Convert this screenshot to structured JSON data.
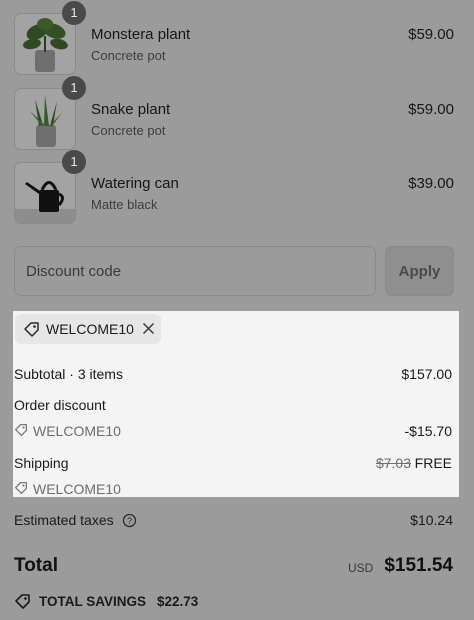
{
  "items": [
    {
      "name": "Monstera plant",
      "variant": "Concrete pot",
      "price": "$59.00",
      "qty": "1"
    },
    {
      "name": "Snake plant",
      "variant": "Concrete pot",
      "price": "$59.00",
      "qty": "1"
    },
    {
      "name": "Watering can",
      "variant": "Matte black",
      "price": "$39.00",
      "qty": "1"
    }
  ],
  "discount": {
    "placeholder": "Discount code",
    "apply_label": "Apply"
  },
  "applied_code": "WELCOME10",
  "summary": {
    "subtotal_label": "Subtotal · 3 items",
    "subtotal_value": "$157.00",
    "order_discount_label": "Order discount",
    "order_discount_code": "WELCOME10",
    "order_discount_value": "-$15.70",
    "shipping_label": "Shipping",
    "shipping_original": "$7.03",
    "shipping_value": "FREE",
    "shipping_code": "WELCOME10",
    "taxes_label": "Estimated taxes",
    "taxes_value": "$10.24",
    "total_label": "Total",
    "currency": "USD",
    "total_value": "$151.54",
    "savings_label": "TOTAL SAVINGS",
    "savings_value": "$22.73"
  }
}
